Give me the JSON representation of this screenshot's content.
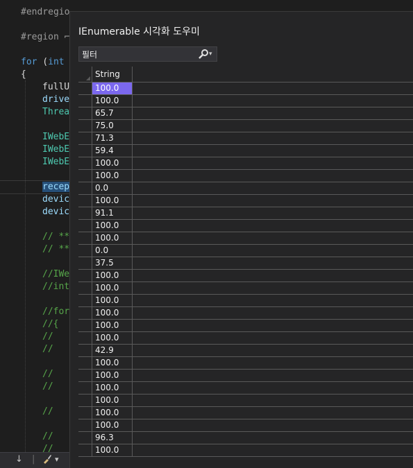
{
  "editor": {
    "lines": [
      {
        "text": "#endregio",
        "kind": "pr"
      },
      {
        "text": "#region ⌐",
        "kind": "pr"
      },
      {
        "text": "for (int",
        "kind": "kw"
      },
      {
        "text": "{",
        "kind": "plain"
      },
      {
        "text": "fullU",
        "kind": "plain"
      },
      {
        "text": "drive",
        "kind": "plain"
      },
      {
        "text": "Threa",
        "kind": "ty"
      },
      {
        "text": "IWebE",
        "kind": "ty"
      },
      {
        "text": "IWebE",
        "kind": "ty"
      },
      {
        "text": "IWebE",
        "kind": "ty"
      },
      {
        "text": "recep",
        "kind": "sel"
      },
      {
        "text": "devic",
        "kind": "plain"
      },
      {
        "text": "devic",
        "kind": "plain"
      },
      {
        "text": "// **",
        "kind": "cm"
      },
      {
        "text": "// **",
        "kind": "cm"
      },
      {
        "text": "//IWe",
        "kind": "cm"
      },
      {
        "text": "//int",
        "kind": "cm"
      },
      {
        "text": "//for",
        "kind": "cm"
      },
      {
        "text": "//{",
        "kind": "cm"
      },
      {
        "text": "//",
        "kind": "cm"
      },
      {
        "text": "//",
        "kind": "cm"
      },
      {
        "text": "//",
        "kind": "cm"
      },
      {
        "text": "//",
        "kind": "cm"
      },
      {
        "text": "//",
        "kind": "cm"
      },
      {
        "text": "//",
        "kind": "cm"
      },
      {
        "text": "//",
        "kind": "cm"
      }
    ],
    "bottom_bar": {
      "down_arrow": "↓",
      "separator": "|",
      "brush_icon": "paint-brush-icon",
      "dropdown": "▾"
    }
  },
  "visualizer": {
    "title": "IEnumerable 시각화 도우미",
    "filter": {
      "value": "필터",
      "search_icon": "search-icon",
      "dropdown_icon": "chevron-down-icon"
    },
    "grid": {
      "column_header": "String",
      "selected_row": 0,
      "rows": [
        "100.0",
        "100.0",
        "65.7",
        "75.0",
        "71.3",
        "59.4",
        "100.0",
        "100.0",
        "0.0",
        "100.0",
        "91.1",
        "100.0",
        "100.0",
        "0.0",
        "37.5",
        "100.0",
        "100.0",
        "100.0",
        "100.0",
        "100.0",
        "100.0",
        "42.9",
        "100.0",
        "100.0",
        "100.0",
        "100.0",
        "100.0",
        "100.0",
        "96.3",
        "100.0"
      ]
    }
  },
  "colors": {
    "selection": "#7b68ee",
    "keyword": "#569cd6",
    "comment": "#57a64a",
    "type": "#4ec9b0"
  }
}
